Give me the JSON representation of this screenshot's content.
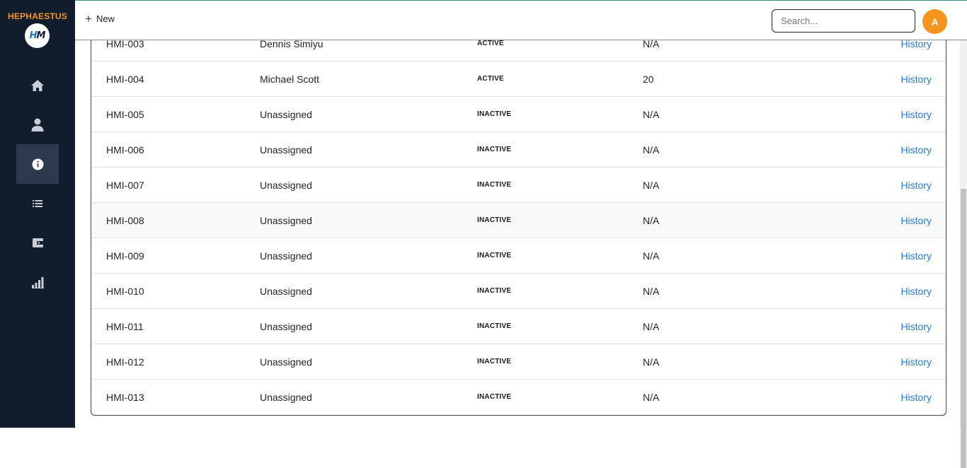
{
  "app": {
    "brand": "HEPHAESTUS",
    "logo_text_a": "H",
    "logo_text_b": "M"
  },
  "sidebar": {
    "items": [
      {
        "name": "home",
        "icon": "home-icon",
        "active": false
      },
      {
        "name": "users",
        "icon": "user-icon",
        "active": false
      },
      {
        "name": "info",
        "icon": "info-icon",
        "active": true
      },
      {
        "name": "list",
        "icon": "list-icon",
        "active": false
      },
      {
        "name": "wallet",
        "icon": "wallet-icon",
        "active": false
      },
      {
        "name": "reports",
        "icon": "bar-chart-icon",
        "active": false
      }
    ]
  },
  "topbar": {
    "new_label": "New",
    "search_placeholder": "Search...",
    "avatar_initial": "A"
  },
  "table": {
    "link_label": "History",
    "rows": [
      {
        "id": "HMI-003",
        "user": "Dennis Simiyu",
        "status": "ACTIVE",
        "value": "N/A",
        "link": "History"
      },
      {
        "id": "HMI-004",
        "user": "Michael Scott",
        "status": "ACTIVE",
        "value": "20",
        "link": "History"
      },
      {
        "id": "HMI-005",
        "user": "Unassigned",
        "status": "INACTIVE",
        "value": "N/A",
        "link": "History"
      },
      {
        "id": "HMI-006",
        "user": "Unassigned",
        "status": "INACTIVE",
        "value": "N/A",
        "link": "History"
      },
      {
        "id": "HMI-007",
        "user": "Unassigned",
        "status": "INACTIVE",
        "value": "N/A",
        "link": "History"
      },
      {
        "id": "HMI-008",
        "user": "Unassigned",
        "status": "INACTIVE",
        "value": "N/A",
        "link": "History"
      },
      {
        "id": "HMI-009",
        "user": "Unassigned",
        "status": "INACTIVE",
        "value": "N/A",
        "link": "History"
      },
      {
        "id": "HMI-010",
        "user": "Unassigned",
        "status": "INACTIVE",
        "value": "N/A",
        "link": "History"
      },
      {
        "id": "HMI-011",
        "user": "Unassigned",
        "status": "INACTIVE",
        "value": "N/A",
        "link": "History"
      },
      {
        "id": "HMI-012",
        "user": "Unassigned",
        "status": "INACTIVE",
        "value": "N/A",
        "link": "History"
      },
      {
        "id": "HMI-013",
        "user": "Unassigned",
        "status": "INACTIVE",
        "value": "N/A",
        "link": "History"
      }
    ]
  },
  "colors": {
    "sidebar_bg": "#111c2d",
    "brand_accent": "#f7941d",
    "link": "#2b7bd6",
    "active_nav": "#2d3a4d"
  }
}
